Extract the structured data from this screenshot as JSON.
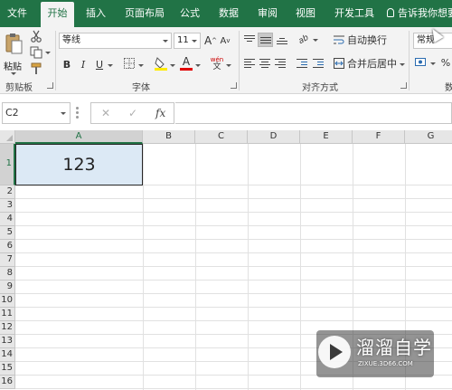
{
  "ribbon_tabs": {
    "file": "文件",
    "home": "开始",
    "insert": "插入",
    "page_layout": "页面布局",
    "formulas": "公式",
    "data": "数据",
    "review": "审阅",
    "view": "视图",
    "developer": "开发工具",
    "tell_me": "告诉我你想要"
  },
  "clipboard": {
    "paste_label": "粘贴",
    "group_label": "剪贴板"
  },
  "font": {
    "font_name": "等线",
    "font_size": "11",
    "grow_label": "A",
    "shrink_label": "A",
    "bold": "B",
    "italic": "I",
    "underline": "U",
    "font_color_glyph": "A",
    "phonetic_glyph": "wén",
    "group_label": "字体"
  },
  "alignment": {
    "wrap_text": "自动换行",
    "merge_center": "合并后居中",
    "orientation_glyph": "ab",
    "group_label": "对齐方式"
  },
  "number": {
    "format": "常规",
    "percent": "%",
    "group_label": "数"
  },
  "formula_bar": {
    "name_box": "C2",
    "cancel": "✕",
    "enter": "✓",
    "fx": "fx",
    "content": ""
  },
  "sheet": {
    "columns": [
      "A",
      "B",
      "C",
      "D",
      "E",
      "F",
      "G"
    ],
    "rows": [
      "1",
      "2",
      "3",
      "4",
      "5",
      "6",
      "7",
      "8",
      "9",
      "10",
      "11",
      "12",
      "13",
      "14",
      "15",
      "16"
    ],
    "cell_A1": "123",
    "selected_column": "A",
    "selected_row": "1"
  },
  "watermark": {
    "title": "溜溜自学",
    "url": "ZIXUE.3D66.COM"
  },
  "colors": {
    "ribbon_green": "#217346",
    "ribbon_body": "#f3f3f3",
    "selected_cell_fill": "#dce9f5",
    "header_gray": "#e6e6e6",
    "gridline": "#e1e1e1",
    "font_color_red": "#e00000",
    "fill_color_yellow": "#ffeb00"
  }
}
